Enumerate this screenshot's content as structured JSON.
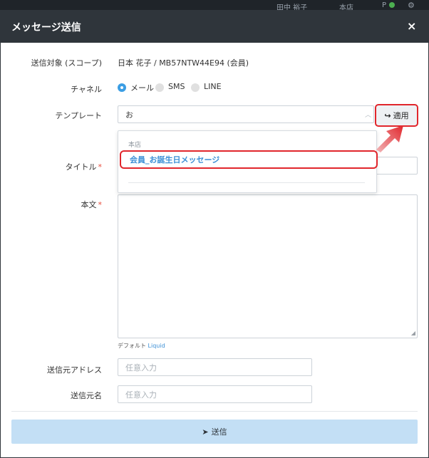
{
  "background": {
    "user_name": "田中 裕子",
    "store": "本店",
    "p_label": "P"
  },
  "modal": {
    "title": "メッセージ送信",
    "close_label": "×"
  },
  "form": {
    "target": {
      "label": "送信対象 (スコープ)",
      "value": "日本 花子 / MB57NTW44E94 (会員)"
    },
    "channel": {
      "label": "チャネル",
      "options": [
        {
          "label": "メール",
          "checked": true
        },
        {
          "label": "SMS",
          "checked": false
        },
        {
          "label": "LINE",
          "checked": false
        }
      ]
    },
    "template": {
      "label": "テンプレート",
      "value": "お",
      "apply_label": "適用",
      "dropdown": {
        "group_label": "本店",
        "items": [
          "会員_お誕生日メッセージ"
        ]
      }
    },
    "title_field": {
      "label": "タイトル",
      "required_mark": "*",
      "value": ""
    },
    "body_field": {
      "label": "本文",
      "required_mark": "*",
      "value": ""
    },
    "hint": {
      "prefix": "デフォルト",
      "link": "Liquid"
    },
    "from_address": {
      "label": "送信元アドレス",
      "placeholder": "任意入力"
    },
    "from_name": {
      "label": "送信元名",
      "placeholder": "任意入力"
    },
    "send_label": "送信"
  },
  "colors": {
    "header_bg": "#2f353b",
    "accent": "#3b9ee4",
    "highlight": "#e1262c",
    "send_bg": "#c3dff5"
  }
}
